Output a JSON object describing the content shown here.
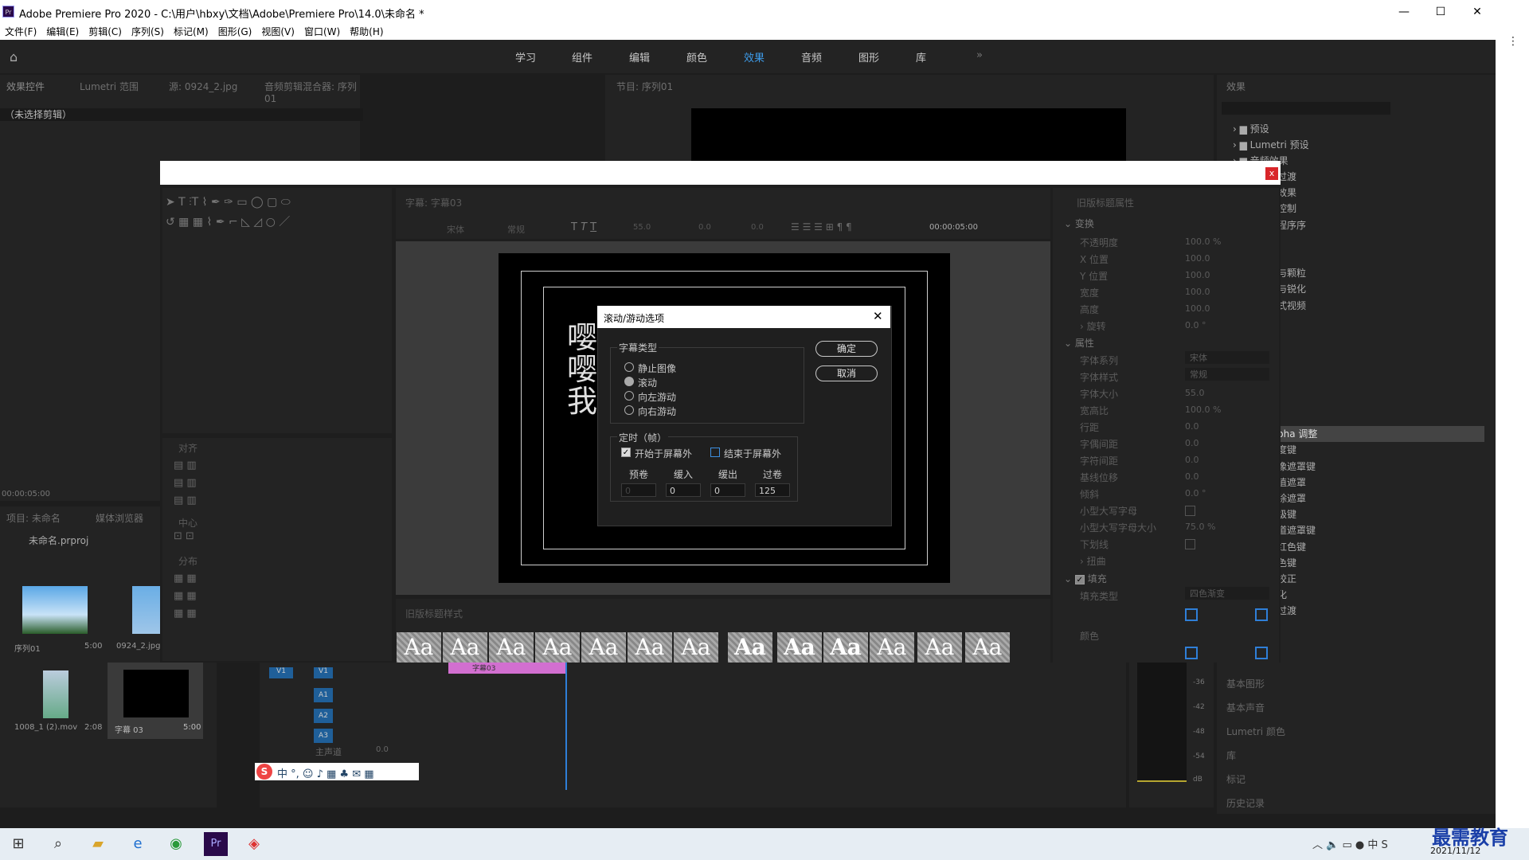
{
  "window": {
    "title": "Adobe Premiere Pro 2020 - C:\\用户\\hbxy\\文档\\Adobe\\Premiere Pro\\14.0\\未命名 *",
    "logo": "Pr"
  },
  "menu": [
    "文件(F)",
    "编辑(E)",
    "剪辑(C)",
    "序列(S)",
    "标记(M)",
    "图形(G)",
    "视图(V)",
    "窗口(W)",
    "帮助(H)"
  ],
  "workspaces": [
    "学习",
    "组件",
    "编辑",
    "颜色",
    "效果",
    "音频",
    "图形",
    "库"
  ],
  "active_workspace": "效果",
  "left_panel": {
    "tabs": [
      "效果控件",
      "Lumetri 范围",
      "源: 0924_2.jpg",
      "音频剪辑混合器: 序列01"
    ],
    "no_clip": "（未选择剪辑）",
    "timecode": "00:00:05:00"
  },
  "program_monitor": {
    "tab": "节目: 序列01"
  },
  "effects_panel": {
    "title": "效果",
    "items": [
      "预设",
      "Lumetri 预设",
      "音频效果",
      "过渡",
      "效果",
      "控制",
      "程序序",
      "",
      "",
      "与颗粒",
      "与锐化",
      "式视频",
      "",
      "",
      "",
      "",
      "",
      "",
      "",
      "pha 调整",
      "度键",
      "像遮罩键",
      "值遮罩",
      "除遮罩",
      "级键",
      "道遮罩键",
      "红色键",
      "色键",
      "校正",
      "化",
      "过渡"
    ],
    "lower": [
      "基本图形",
      "基本声音",
      "Lumetri 颜色",
      "库",
      "标记",
      "历史记录"
    ]
  },
  "project_panel": {
    "tabs": [
      "项目: 未命名",
      "媒体浏览器"
    ],
    "project_file": "未命名.prproj",
    "items": [
      {
        "name": "序列01",
        "dur": "5:00"
      },
      {
        "name": "0924_2.jpg",
        "dur": ""
      },
      {
        "name": "1008_1 (2).mov",
        "dur": "2:08"
      },
      {
        "name": "字幕 03",
        "dur": "5:00"
      }
    ]
  },
  "titler": {
    "panel_title": "字幕: 字幕03",
    "font": "宋体",
    "style": "常规",
    "size": "55.0",
    "kerning": "0.0",
    "leading": "0.0",
    "timecode": "00:00:05:00",
    "vertical_text": "嘤嘤我",
    "align_label": "对齐",
    "center_label": "中心",
    "distribute_label": "分布",
    "styles_title": "旧版标题样式",
    "style_samples": [
      "Aa",
      "Aa",
      "Aa",
      "Aa",
      "Aa",
      "Aa",
      "Aa",
      "Aa",
      "Aa",
      "Aa",
      "Aa",
      "Aa",
      "Aa"
    ],
    "close": "x"
  },
  "properties": {
    "title": "旧版标题属性",
    "transform": "变换",
    "transform_rows": [
      {
        "k": "不透明度",
        "v": "100.0 %"
      },
      {
        "k": "X 位置",
        "v": "100.0"
      },
      {
        "k": "Y 位置",
        "v": "100.0"
      },
      {
        "k": "宽度",
        "v": "100.0"
      },
      {
        "k": "高度",
        "v": "100.0"
      },
      {
        "k": "旋转",
        "v": "0.0 °"
      }
    ],
    "attributes": "属性",
    "attr_rows": [
      {
        "k": "字体系列",
        "v": "宋体"
      },
      {
        "k": "字体样式",
        "v": "常规"
      },
      {
        "k": "字体大小",
        "v": "55.0"
      },
      {
        "k": "宽高比",
        "v": "100.0 %"
      },
      {
        "k": "行距",
        "v": "0.0"
      },
      {
        "k": "字偶间距",
        "v": "0.0"
      },
      {
        "k": "字符间距",
        "v": "0.0"
      },
      {
        "k": "基线位移",
        "v": "0.0"
      },
      {
        "k": "倾斜",
        "v": "0.0 °"
      },
      {
        "k": "小型大写字母",
        "v": ""
      },
      {
        "k": "小型大写字母大小",
        "v": "75.0 %"
      },
      {
        "k": "下划线",
        "v": ""
      },
      {
        "k": "扭曲",
        "v": ""
      }
    ],
    "fill": "填充",
    "fill_type_label": "填充类型",
    "fill_type": "四色渐变",
    "color_label": "颜色"
  },
  "roll_dialog": {
    "title": "滚动/游动选项",
    "type_group": "字幕类型",
    "types": [
      "静止图像",
      "滚动",
      "向左游动",
      "向右游动"
    ],
    "selected_type": 1,
    "ok": "确定",
    "cancel": "取消",
    "timing_group": "定时（帧）",
    "start_off": "开始于屏幕外",
    "end_off": "结束于屏幕外",
    "fields": [
      {
        "label": "预卷",
        "value": "0"
      },
      {
        "label": "缓入",
        "value": "0"
      },
      {
        "label": "缓出",
        "value": "0"
      },
      {
        "label": "过卷",
        "value": "125"
      }
    ]
  },
  "timeline": {
    "tracks": [
      "V1",
      "A1",
      "A2",
      "A3"
    ],
    "master": "主声道",
    "master_val": "0.0",
    "clip": "字幕03"
  },
  "meter": {
    "labels": [
      "-36",
      "-42",
      "-48",
      "-54",
      "dB"
    ]
  },
  "taskbar": {
    "date": "2021/11/12",
    "watermark": "最需教育"
  }
}
